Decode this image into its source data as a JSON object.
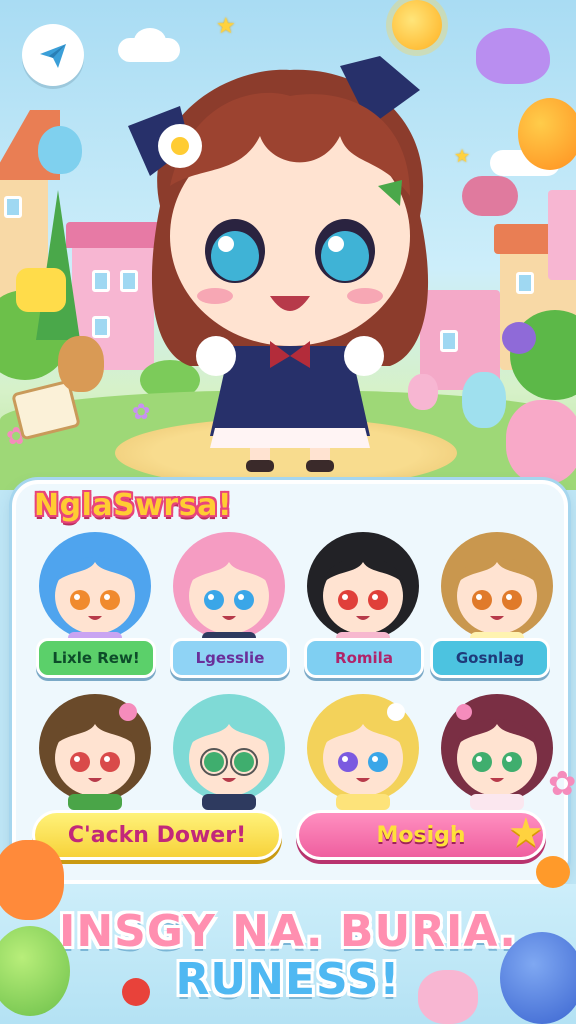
{
  "panel": {
    "title": "NglaSwrsa!"
  },
  "characters": [
    {
      "name": "Lixle Rew!",
      "hair": "#4fa4ee",
      "eyes": "#f08a2e",
      "outfit": "#c9a4f2",
      "pill_color": "#5bd06a",
      "text_color": "#0d4c2a"
    },
    {
      "name": "Lgesslie",
      "hair": "#f59cc2",
      "eyes": "#3aa6e8",
      "outfit": "#2e3a5f",
      "pill_color": "#8fd3f5",
      "text_color": "#6a2f9a"
    },
    {
      "name": "Romila",
      "hair": "#222226",
      "eyes": "#e0403a",
      "outfit": "#f7b8cf",
      "pill_color": "#7fcff2",
      "text_color": "#b0236a"
    },
    {
      "name": "Gosnlag",
      "hair": "#c9974e",
      "eyes": "#e07a2a",
      "outfit": "#fff3b0",
      "pill_color": "#4cc3e0",
      "text_color": "#1f3a7a"
    }
  ],
  "characters_row2": [
    {
      "hair": "#6a4a2a",
      "eyes": "#d94a4a",
      "outfit": "#4aa548"
    },
    {
      "hair": "#7fdad6",
      "eyes": "#3fae6e",
      "outfit": "#2e3a5f"
    },
    {
      "hair": "#f3d25a",
      "eyes": "#7b5ae0",
      "outfit": "#fde37a"
    },
    {
      "hair": "#7a2f44",
      "eyes": "#3fae6e",
      "outfit": "#fbe7ef"
    }
  ],
  "buttons": {
    "left_label": "C'ackn Dower!",
    "right_label": "Mosigh"
  },
  "footer": {
    "line1": "INSGY NA. BURIA.",
    "line2": "RUNESS!"
  },
  "icons": {
    "back": "paper-plane-icon",
    "favorite": "star-icon"
  },
  "colors": {
    "accent_pink": "#e8457a",
    "accent_yellow": "#ffcc33",
    "sky": "#a9dcf3"
  }
}
